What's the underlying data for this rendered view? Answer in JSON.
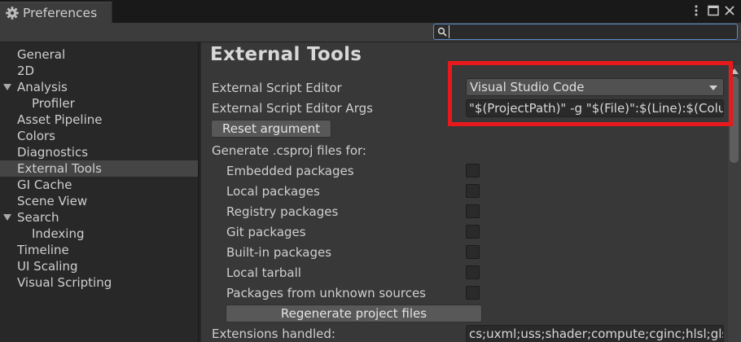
{
  "window": {
    "tab_title": "Preferences",
    "gear_icon": "gear-icon",
    "menu_icon": "kebab-menu-icon",
    "maximize_icon": "maximize-icon",
    "close_icon": "close-icon"
  },
  "search": {
    "icon": "search-icon",
    "value": "",
    "placeholder": ""
  },
  "sidebar": {
    "items": [
      {
        "label": "General",
        "level": 0,
        "expandable": false,
        "selected": false
      },
      {
        "label": "2D",
        "level": 0,
        "expandable": false,
        "selected": false
      },
      {
        "label": "Analysis",
        "level": 0,
        "expandable": true,
        "selected": false
      },
      {
        "label": "Profiler",
        "level": 1,
        "expandable": false,
        "selected": false
      },
      {
        "label": "Asset Pipeline",
        "level": 0,
        "expandable": false,
        "selected": false
      },
      {
        "label": "Colors",
        "level": 0,
        "expandable": false,
        "selected": false
      },
      {
        "label": "Diagnostics",
        "level": 0,
        "expandable": false,
        "selected": false
      },
      {
        "label": "External Tools",
        "level": 0,
        "expandable": false,
        "selected": true
      },
      {
        "label": "GI Cache",
        "level": 0,
        "expandable": false,
        "selected": false
      },
      {
        "label": "Scene View",
        "level": 0,
        "expandable": false,
        "selected": false
      },
      {
        "label": "Search",
        "level": 0,
        "expandable": true,
        "selected": false
      },
      {
        "label": "Indexing",
        "level": 1,
        "expandable": false,
        "selected": false
      },
      {
        "label": "Timeline",
        "level": 0,
        "expandable": false,
        "selected": false
      },
      {
        "label": "UI Scaling",
        "level": 0,
        "expandable": false,
        "selected": false
      },
      {
        "label": "Visual Scripting",
        "level": 0,
        "expandable": false,
        "selected": false
      }
    ]
  },
  "main": {
    "heading": "External Tools",
    "script_editor": {
      "label": "External Script Editor",
      "value": "Visual Studio Code"
    },
    "script_editor_args": {
      "label": "External Script Editor Args",
      "value": "\"$(ProjectPath)\" -g \"$(File)\":$(Line):$(Column)"
    },
    "reset_button": "Reset argument",
    "generate_label": "Generate .csproj files for:",
    "packages": [
      {
        "label": "Embedded packages",
        "checked": false
      },
      {
        "label": "Local packages",
        "checked": false
      },
      {
        "label": "Registry packages",
        "checked": false
      },
      {
        "label": "Git packages",
        "checked": false
      },
      {
        "label": "Built-in packages",
        "checked": false
      },
      {
        "label": "Local tarball",
        "checked": false
      },
      {
        "label": "Packages from unknown sources",
        "checked": false
      }
    ],
    "regenerate_button": "Regenerate project files",
    "extensions": {
      "label": "Extensions handled:",
      "value": "cs;uxml;uss;shader;compute;cginc;hlsl;glslinc"
    }
  },
  "colors": {
    "highlight": "#e8191c",
    "focus_border": "#5a8bd0"
  }
}
